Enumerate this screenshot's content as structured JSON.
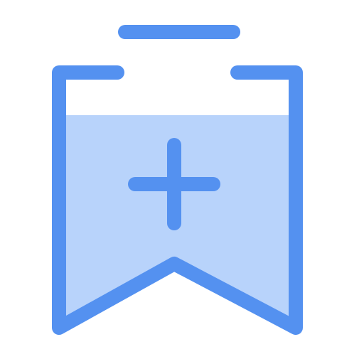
{
  "icon": {
    "name": "bookmark-add-icon",
    "stroke_color": "#5491f0",
    "fill_color": "#b8d3fb"
  }
}
